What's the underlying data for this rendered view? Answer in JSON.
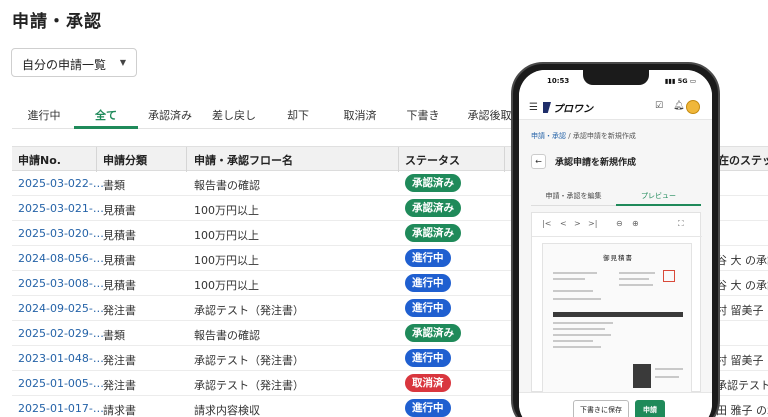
{
  "page_title": "申請・承認",
  "filter": {
    "value": "自分の申請一覧"
  },
  "tabs": [
    "進行中",
    "全て",
    "承認済み",
    "差し戻し",
    "却下",
    "取消済",
    "下書き",
    "承認後取消"
  ],
  "active_tab": "全て",
  "table": {
    "headers": [
      "申請No.",
      "申請分類",
      "申請・承認フロー名",
      "ステータス",
      "在のステッ"
    ],
    "rows": [
      {
        "id": "2025-03-022-…",
        "category": "書類",
        "flow": "報告書の確認",
        "status": "承認済み",
        "right": ""
      },
      {
        "id": "2025-03-021-…",
        "category": "見積書",
        "flow": "100万円以上",
        "status": "承認済み",
        "right": ""
      },
      {
        "id": "2025-03-020-…",
        "category": "見積書",
        "flow": "100万円以上",
        "status": "承認済み",
        "right": ""
      },
      {
        "id": "2024-08-056-…",
        "category": "見積書",
        "flow": "100万円以上",
        "status": "進行中",
        "right": "谷 大 の承認"
      },
      {
        "id": "2025-03-008-…",
        "category": "見積書",
        "flow": "100万円以上",
        "status": "進行中",
        "right": "谷 大 の承認"
      },
      {
        "id": "2024-09-025-…",
        "category": "発注書",
        "flow": "承認テスト（発注書）",
        "status": "進行中",
        "right": "村 留美子 の"
      },
      {
        "id": "2025-02-029-…",
        "category": "書類",
        "flow": "報告書の確認",
        "status": "承認済み",
        "right": ""
      },
      {
        "id": "2023-01-048-…",
        "category": "発注書",
        "flow": "承認テスト（発注書）",
        "status": "進行中",
        "right": "村 留美子 の"
      },
      {
        "id": "2025-01-005-…",
        "category": "発注書",
        "flow": "承認テスト（発注書）",
        "status": "取消済",
        "right": "承認テストの"
      },
      {
        "id": "2025-01-017-…",
        "category": "請求書",
        "flow": "請求内容検収",
        "status": "進行中",
        "right": "田 雅子 の承"
      }
    ]
  },
  "status_colors": {
    "承認済み": "#1f8a5a",
    "進行中": "#1f5fd0",
    "取消済": "#d9363e"
  },
  "phone": {
    "time": "10:53",
    "signal": "5G",
    "app_name": "プロワン",
    "breadcrumb_link": "申請・承認",
    "breadcrumb_sep": "/",
    "breadcrumb_current": "承認申請を新規作成",
    "page_title": "承認申請を新規作成",
    "tabs": [
      "申請・承認を編集",
      "プレビュー"
    ],
    "active_tab": "プレビュー",
    "doc_title": "御見積書",
    "save_draft": "下書きに保存",
    "submit": "申請"
  }
}
